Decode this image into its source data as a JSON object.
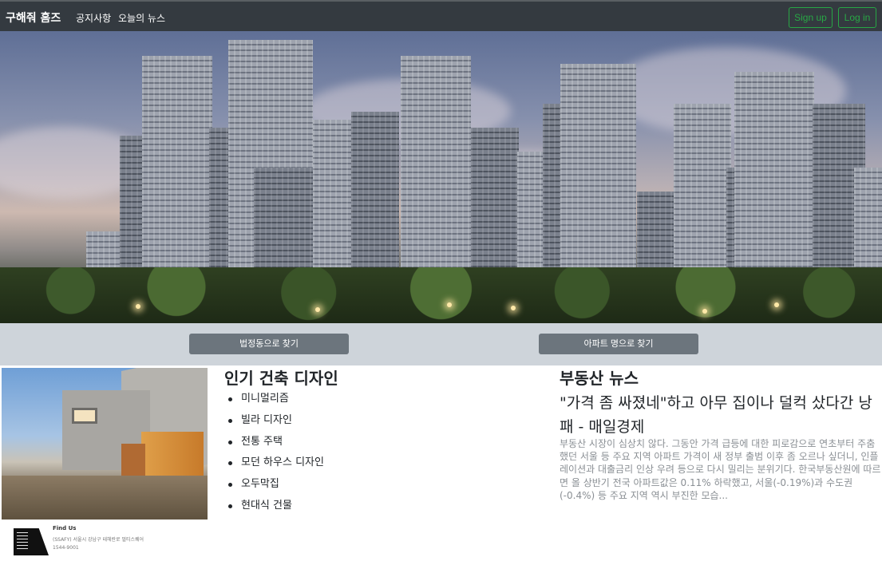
{
  "navbar": {
    "brand": "구해줘 홈즈",
    "links": [
      "공지사항",
      "오늘의 뉴스"
    ],
    "signup_label": "Sign up",
    "login_label": "Log in",
    "accent_color": "#28a745"
  },
  "search": {
    "by_dong_label": "법정동으로 찾기",
    "by_apt_label": "아파트 명으로 찾기"
  },
  "design": {
    "title": "인기 건축 디자인",
    "items": [
      "미니멀리즘",
      "빌라 디자인",
      "전통 주택",
      "모던 하우스 디자인",
      "오두막집",
      "현대식 건물"
    ]
  },
  "news": {
    "title": "부동산 뉴스",
    "headline": "\"가격 좀 싸졌네\"하고 아무 집이나 덜컥 샀다간 낭패 - 매일경제",
    "body": "부동산 시장이 심상치 않다. 그동안 가격 급등에 대한 피로감으로 연초부터 주춤했던 서울 등 주요 지역 아파트 가격이 새 정부 출범 이후 좀 오르나 싶더니, 인플레이션과 대출금리 인상 우려 등으로 다시 밀리는 분위기다. 한국부동산원에 따르면 올 상반기 전국 아파트값은 0.11% 하락했고, 서울(-0.19%)과 수도권(-0.4%) 등 주요 지역 역시 부진한 모습..."
  },
  "footer": {
    "title": "Find Us",
    "address": "(SSAFY) 서울시 강남구 테헤란로 멀티스퀘어",
    "phone": "1544-9001"
  }
}
